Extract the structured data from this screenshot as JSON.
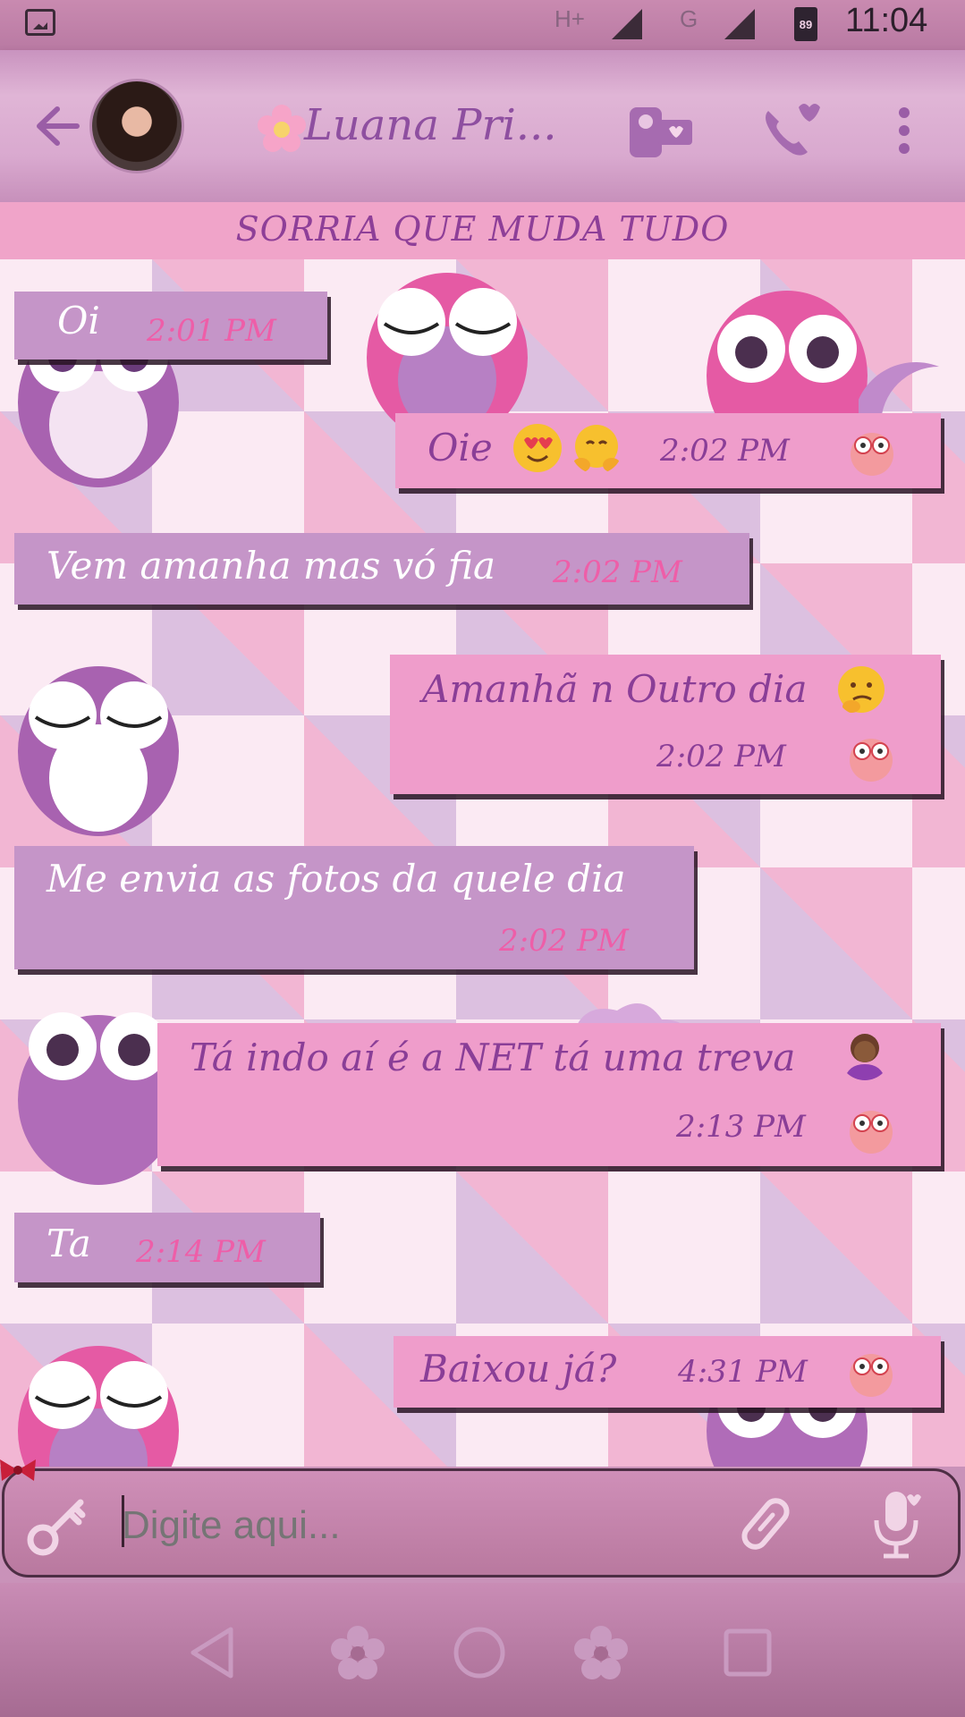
{
  "status_bar": {
    "net_label_1": "H+",
    "net_label_2": "G",
    "battery_level": "89",
    "time": "11:04"
  },
  "header": {
    "contact_name": "Luana Pri...",
    "icons": [
      "back-arrow-icon",
      "avatar",
      "video-call-icon",
      "voice-call-icon",
      "more-options-icon"
    ]
  },
  "banner": {
    "status_text": "SORRIA QUE MUDA TUDO"
  },
  "messages": [
    {
      "direction": "in",
      "text": "Oi",
      "time": "2:01 PM"
    },
    {
      "direction": "out",
      "text": "Oie",
      "time": "2:02 PM"
    },
    {
      "direction": "in",
      "text": "Vem amanha mas vó fia",
      "time": "2:02 PM"
    },
    {
      "direction": "out",
      "text": "Amanhã n Outro dia",
      "time": "2:02 PM"
    },
    {
      "direction": "in",
      "text": "Me envia as fotos da quele dia",
      "time": "2:02 PM"
    },
    {
      "direction": "out",
      "text": "Tá indo aí é a NET tá uma treva",
      "time": "2:13 PM"
    },
    {
      "direction": "in",
      "text": "Ta",
      "time": "2:14 PM"
    },
    {
      "direction": "out",
      "text": "Baixou já?",
      "time": "4:31 PM"
    }
  ],
  "input": {
    "placeholder": "Digite aqui..."
  },
  "colors": {
    "incoming_bubble": "#c595c8",
    "outgoing_bubble": "#ef9dcb",
    "time_in": "#ee5ea8",
    "text_out": "#8a3e97"
  }
}
